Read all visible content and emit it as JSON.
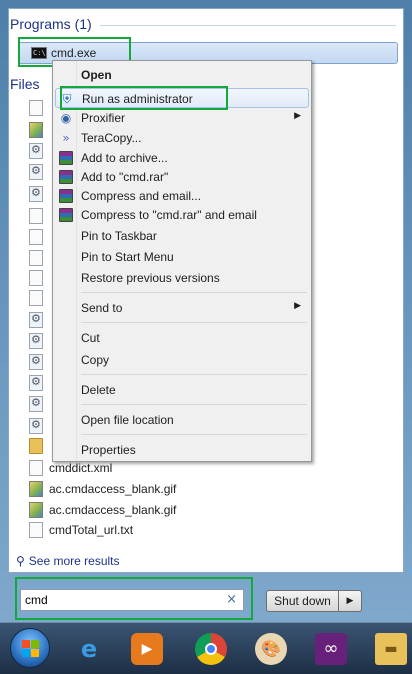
{
  "search_results": {
    "programs_header": "Programs (1)",
    "program_item": "cmd.exe",
    "program_icon": "cmd-icon",
    "files_header": "Files",
    "files": [
      {
        "label": "cmddict.xml",
        "icon": "document-icon"
      },
      {
        "label": "ac.cmdaccess_blank.gif",
        "icon": "image-icon"
      },
      {
        "label": "ac.cmdaccess_blank.gif",
        "icon": "image-icon"
      },
      {
        "label": "cmdTotal_url.txt",
        "icon": "document-icon"
      }
    ],
    "see_more": "See more results"
  },
  "context_menu": {
    "items": [
      {
        "label": "Open",
        "bold": true,
        "icon": ""
      },
      {
        "label": "Run as administrator",
        "icon": "shield-icon"
      },
      {
        "label": "Proxifier",
        "icon": "proxifier-icon",
        "submenu": true
      },
      {
        "label": "TeraCopy...",
        "icon": "teracopy-icon"
      },
      {
        "label": "Add to archive...",
        "icon": "winrar-icon"
      },
      {
        "label": "Add to \"cmd.rar\"",
        "icon": "winrar-icon"
      },
      {
        "label": "Compress and email...",
        "icon": "winrar-icon"
      },
      {
        "label": "Compress to \"cmd.rar\" and email",
        "icon": "winrar-icon"
      },
      {
        "label": "Pin to Taskbar",
        "icon": ""
      },
      {
        "label": "Pin to Start Menu",
        "icon": ""
      },
      {
        "label": "Restore previous versions",
        "icon": ""
      },
      {
        "label": "Send to",
        "icon": "",
        "submenu": true
      },
      {
        "label": "Cut",
        "icon": ""
      },
      {
        "label": "Copy",
        "icon": ""
      },
      {
        "label": "Delete",
        "icon": ""
      },
      {
        "label": "Open file location",
        "icon": ""
      },
      {
        "label": "Properties",
        "icon": ""
      }
    ]
  },
  "search": {
    "value": "cmd",
    "clear_glyph": "×"
  },
  "shutdown": {
    "label": "Shut down",
    "arrow": "▶"
  },
  "taskbar": {
    "items": [
      {
        "icon": "windows-start-orb-icon"
      },
      {
        "icon": "internet-explorer-icon"
      },
      {
        "icon": "media-player-icon"
      },
      {
        "icon": "chrome-icon"
      },
      {
        "icon": "paint-palette-icon"
      },
      {
        "icon": "visual-studio-icon"
      },
      {
        "icon": "file-explorer-icon"
      }
    ]
  },
  "colors": {
    "highlight_box": "#12a83a",
    "header_text": "#1e3287",
    "taskbar": "#1d2f45"
  }
}
